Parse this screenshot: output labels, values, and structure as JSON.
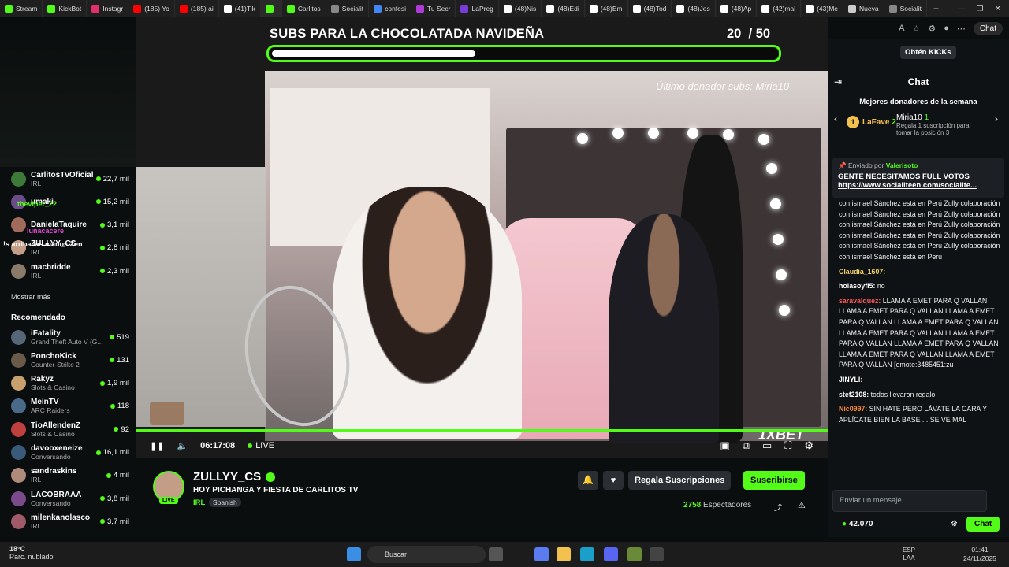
{
  "browser": {
    "tabs": [
      {
        "label": "Stream",
        "color": "#53fc18"
      },
      {
        "label": "KickBot",
        "color": "#53fc18"
      },
      {
        "label": "Instagr",
        "color": "#e1306c"
      },
      {
        "label": "(185) Yo",
        "color": "#ff0000"
      },
      {
        "label": "(185) ai",
        "color": "#ff0000"
      },
      {
        "label": "(41)Tik",
        "color": "#ffffff"
      },
      {
        "label": "",
        "color": "#53fc18"
      },
      {
        "label": "Carlitos",
        "color": "#53fc18"
      },
      {
        "label": "Socialit",
        "color": "#888888"
      },
      {
        "label": "confesi",
        "color": "#4285f4"
      },
      {
        "label": "Tu Secr",
        "color": "#b13bd8"
      },
      {
        "label": "LaPreg",
        "color": "#7a3cd8"
      },
      {
        "label": "(48)Nis",
        "color": "#ffffff"
      },
      {
        "label": "(48)Edi",
        "color": "#ffffff"
      },
      {
        "label": "(48)Em",
        "color": "#ffffff"
      },
      {
        "label": "(48)Tod",
        "color": "#ffffff"
      },
      {
        "label": "(48)Jos",
        "color": "#ffffff"
      },
      {
        "label": "(48)Ap",
        "color": "#ffffff"
      },
      {
        "label": "(42)mal",
        "color": "#ffffff"
      },
      {
        "label": "(43)Me",
        "color": "#ffffff"
      },
      {
        "label": "Nueva",
        "color": "#cccccc"
      },
      {
        "label": "Socialit",
        "color": "#888888"
      }
    ],
    "chat_button": "Chat"
  },
  "sidebar": {
    "following": [
      {
        "name": "CarlitosTvOficial",
        "category": "IRL",
        "viewers": "22,7 mil",
        "color": "#3d7a3a"
      },
      {
        "name": "umaki",
        "category": "",
        "viewers": "15,2 mil",
        "color": "#6b4b8a"
      },
      {
        "name": "DanielaTaquire",
        "category": "",
        "viewers": "3,1 mil",
        "color": "#a06b5a"
      },
      {
        "name": "ZULLYY_CS",
        "category": "IRL",
        "viewers": "2,8 mil",
        "color": "#c49d86"
      },
      {
        "name": "macbridde",
        "category": "IRL",
        "viewers": "2,3 mil",
        "color": "#8a7a6a"
      }
    ],
    "overlay_chat": [
      {
        "text": "theviper_22",
        "color": "#53fc18"
      },
      {
        "text": "lunacacere",
        "color": "#e34bd1"
      },
      {
        "text": "!s arriba las manos Zen",
        "color": "#ffffff"
      }
    ],
    "show_more": "Mostrar más",
    "recommended_title": "Recomendado",
    "recommended": [
      {
        "name": "iFatality",
        "category": "Grand Theft Auto V (G...",
        "viewers": "519",
        "color": "#556677"
      },
      {
        "name": "PonchoKick",
        "category": "Counter-Strike 2",
        "viewers": "131",
        "color": "#6a5a4a"
      },
      {
        "name": "Rakyz",
        "category": "Slots & Casino",
        "viewers": "1,9 mil",
        "color": "#c8a070"
      },
      {
        "name": "MeinTV",
        "category": "ARC Raiders",
        "viewers": "118",
        "color": "#4a6a8a"
      },
      {
        "name": "TioAllendenZ",
        "category": "Slots & Casino",
        "viewers": "92",
        "color": "#c04040"
      },
      {
        "name": "davooxeneize",
        "category": "Conversando",
        "viewers": "16,1 mil",
        "color": "#3a5a7a"
      },
      {
        "name": "sandraskins",
        "category": "IRL",
        "viewers": "4 mil",
        "color": "#b08a7a"
      },
      {
        "name": "LACOBRAAA",
        "category": "Conversando",
        "viewers": "3,8 mil",
        "color": "#7a4a8a"
      },
      {
        "name": "milenkanolasco",
        "category": "IRL",
        "viewers": "3,7 mil",
        "color": "#a05a6a"
      }
    ]
  },
  "stream": {
    "goal_title": "SUBS PARA LA CHOCOLATADA NAVIDEÑA",
    "goal_current": "20",
    "goal_target": "/ 50",
    "goal_progress": 0.4,
    "donor_overlay": "Último donador subs: Miria10",
    "brand_overlay": "1XBET",
    "elapsed": "06:17:08",
    "live_label": "LIVE",
    "bulb_positions_note": ""
  },
  "channel": {
    "name": "ZULLYY_CS",
    "live_badge": "LIVE",
    "title": "HOY PICHANGA Y FIESTA DE CARLITOS TV",
    "category": "IRL",
    "language": "Spanish",
    "gift_label": "Regala Suscripciones",
    "subscribe_label": "Suscribirse",
    "viewers_count": "2758",
    "viewers_label": "Espectadores"
  },
  "chat": {
    "kicks_label": "Obtén KICKs",
    "title": "Chat",
    "donors_title": "Mejores donadores de la semana",
    "donor_first": {
      "rank": "1",
      "name": "LaFave",
      "count": "2"
    },
    "donor_second": {
      "name": "Miria10",
      "count": "1",
      "note": "Regala 1 suscripción para tomar la posición 3"
    },
    "pinned_by_label": "Enviado por",
    "pinned_by": "Valerisoto",
    "pinned_msg": "GENTE NECESITAMOS FULL VOTOS",
    "pinned_link": "https://www.socialiteen.com/socialite...",
    "messages": [
      {
        "user": "",
        "color": "#ffffff",
        "text": "con ismael Sánchez está en Perú Zully colaboración con ismael Sánchez está en Perú Zully colaboración con ismael Sánchez está en Perú Zully colaboración con ismael Sánchez está en Perú Zully colaboración con ismael Sánchez está en Perú Zully colaboración con ismael Sánchez está en Perú"
      },
      {
        "user": "Claudia_1607:",
        "color": "#f3d36b",
        "text": ""
      },
      {
        "user": "holasoyfi5:",
        "color": "#ffffff",
        "text": "no"
      },
      {
        "user": "saravalquez:",
        "color": "#ff5a5a",
        "text": "LLAMA A EMET PARA Q VALLAN LLAMA A EMET PARA Q VALLAN LLAMA A EMET PARA Q VALLAN LLAMA A EMET PARA Q VALLAN LLAMA A EMET PARA Q VALLAN LLAMA A EMET PARA Q VALLAN LLAMA A EMET PARA Q VALLAN LLAMA A EMET PARA Q VALLAN LLAMA A EMET PARA Q VALLAN [emote:3485451:zu"
      },
      {
        "user": "JINYLI:",
        "color": "#ffffff",
        "text": ""
      },
      {
        "user": "stef2108:",
        "color": "#ffffff",
        "text": "todos llevaron regalo"
      },
      {
        "user": "Nic0997:",
        "color": "#ff8a3c",
        "text": "SIN HATE PERO LÁVATE LA CARA Y APLÍCATE BIEN LA BASE ... SE VE MAL"
      }
    ],
    "input_placeholder": "Enviar un mensaje",
    "balance": "42.070",
    "send_label": "Chat"
  },
  "taskbar": {
    "temperature": "18°C",
    "weather": "Parc. nublado",
    "search": "Buscar",
    "lang_top": "ESP",
    "lang_bottom": "LAA",
    "time": "01:41",
    "date": "24/11/2025"
  }
}
